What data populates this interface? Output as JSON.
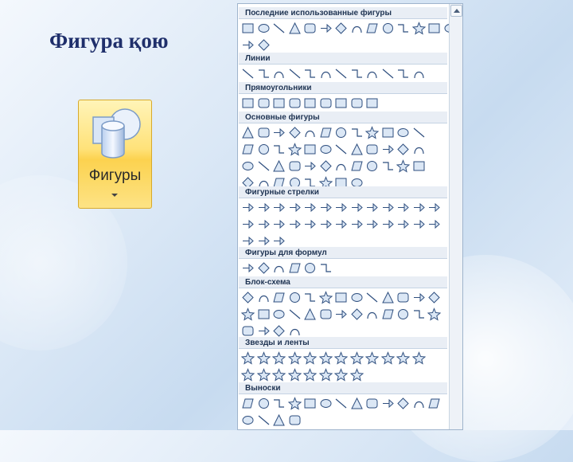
{
  "slide": {
    "title": "Фигура қою"
  },
  "shapes_button": {
    "label": "Фигуры",
    "icon": "shapes-icon"
  },
  "gallery": {
    "sections": [
      {
        "label": "Последние использованные фигуры",
        "rows": 2,
        "counts": [
          14,
          2
        ]
      },
      {
        "label": "Линии",
        "rows": 1,
        "counts": [
          12
        ]
      },
      {
        "label": "Прямоугольники",
        "rows": 1,
        "counts": [
          9
        ]
      },
      {
        "label": "Основные фигуры",
        "rows": 4,
        "counts": [
          12,
          12,
          12,
          8
        ]
      },
      {
        "label": "Фигурные стрелки",
        "rows": 3,
        "counts": [
          13,
          13,
          3
        ]
      },
      {
        "label": "Фигуры для формул",
        "rows": 1,
        "counts": [
          6
        ]
      },
      {
        "label": "Блок-схема",
        "rows": 3,
        "counts": [
          13,
          13,
          4
        ]
      },
      {
        "label": "Звезды и ленты",
        "rows": 2,
        "counts": [
          12,
          8
        ]
      },
      {
        "label": "Выноски",
        "rows": 2,
        "counts": [
          13,
          4
        ]
      }
    ]
  },
  "colors": {
    "accent": "#1f2f6b",
    "button": "#fcd24f",
    "shape_stroke": "#2f4f7f",
    "shape_fill": "#dbe7f5"
  }
}
